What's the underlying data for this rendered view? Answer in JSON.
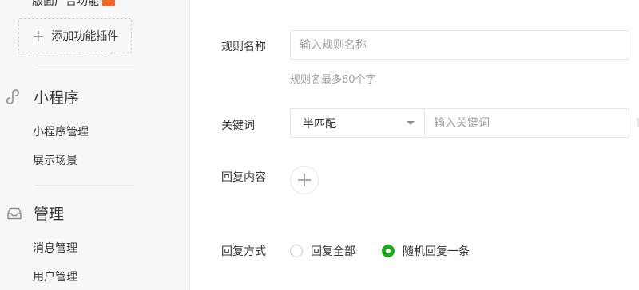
{
  "sidebar": {
    "cut_item_label": "版面广告功能",
    "add_plugin_label": "添加功能插件",
    "sections": [
      {
        "title": "小程序",
        "icon": "mini-program-icon",
        "items": [
          "小程序管理",
          "展示场景"
        ]
      },
      {
        "title": "管理",
        "icon": "inbox-icon",
        "items": [
          "消息管理",
          "用户管理"
        ]
      }
    ]
  },
  "form": {
    "rule_name": {
      "label": "规则名称",
      "placeholder": "输入规则名称",
      "hint": "规则名最多60个字"
    },
    "keyword": {
      "label": "关键词",
      "match_mode": "半匹配",
      "placeholder": "输入关键词"
    },
    "reply_content": {
      "label": "回复内容"
    },
    "reply_mode": {
      "label": "回复方式",
      "options": [
        {
          "label": "回复全部",
          "checked": false
        },
        {
          "label": "随机回复一条",
          "checked": true
        }
      ]
    }
  },
  "colors": {
    "accent": "#1aad19",
    "badge": "#f0672c",
    "sidebar_bg": "#f6f7f8"
  }
}
